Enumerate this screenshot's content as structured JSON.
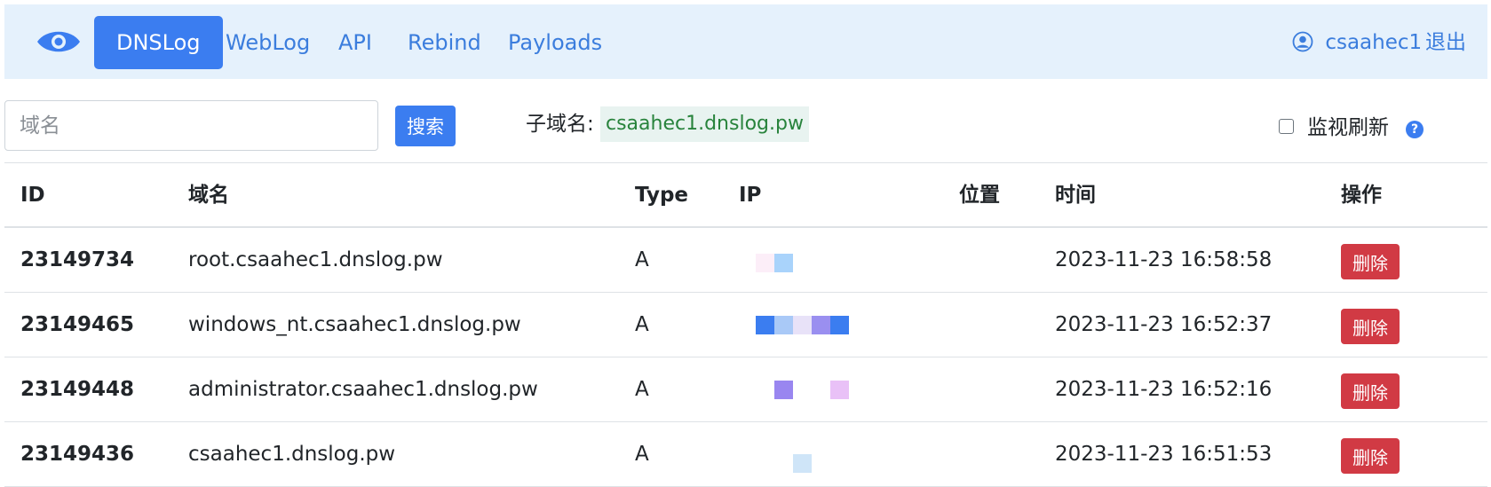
{
  "nav": {
    "logo": "eye-icon",
    "items": [
      {
        "label": "DNSLog",
        "active": true
      },
      {
        "label": "WebLog",
        "active": false
      },
      {
        "label": "API",
        "active": false
      },
      {
        "label": "Rebind",
        "active": false
      },
      {
        "label": "Payloads",
        "active": false
      }
    ],
    "user": {
      "icon": "user-circle-icon",
      "name": "csaahec1"
    },
    "logout": "退出"
  },
  "toolbar": {
    "search_placeholder": "域名",
    "search_value": "",
    "search_button": "搜索",
    "subdomain_label": "子域名:",
    "subdomain_value": "csaahec1.dnslog.pw",
    "watch_label": "监视刷新",
    "watch_checked": false,
    "help_icon": "question-circle-icon",
    "help_glyph": "?"
  },
  "table": {
    "columns": {
      "id": "ID",
      "domain": "域名",
      "type": "Type",
      "ip": "IP",
      "location": "位置",
      "time": "时间",
      "action": "操作"
    },
    "rows": [
      {
        "id": "23149734",
        "domain": "root.csaahec1.dnslog.pw",
        "type": "A",
        "ip": "",
        "location": "",
        "time": "2023-11-23 16:58:58",
        "action": "删除"
      },
      {
        "id": "23149465",
        "domain": "windows_nt.csaahec1.dnslog.pw",
        "type": "A",
        "ip": "",
        "location": "",
        "time": "2023-11-23 16:52:37",
        "action": "删除"
      },
      {
        "id": "23149448",
        "domain": "administrator.csaahec1.dnslog.pw",
        "type": "A",
        "ip": "",
        "location": "",
        "time": "2023-11-23 16:52:16",
        "action": "删除"
      },
      {
        "id": "23149436",
        "domain": "csaahec1.dnslog.pw",
        "type": "A",
        "ip": "",
        "location": "",
        "time": "2023-11-23 16:51:53",
        "action": "删除"
      }
    ]
  },
  "colors": {
    "nav_bg": "#e5f1fc",
    "primary": "#3b7df0",
    "link": "#3b7ddd",
    "danger": "#d13a44",
    "subdomain_text": "#28833c"
  }
}
